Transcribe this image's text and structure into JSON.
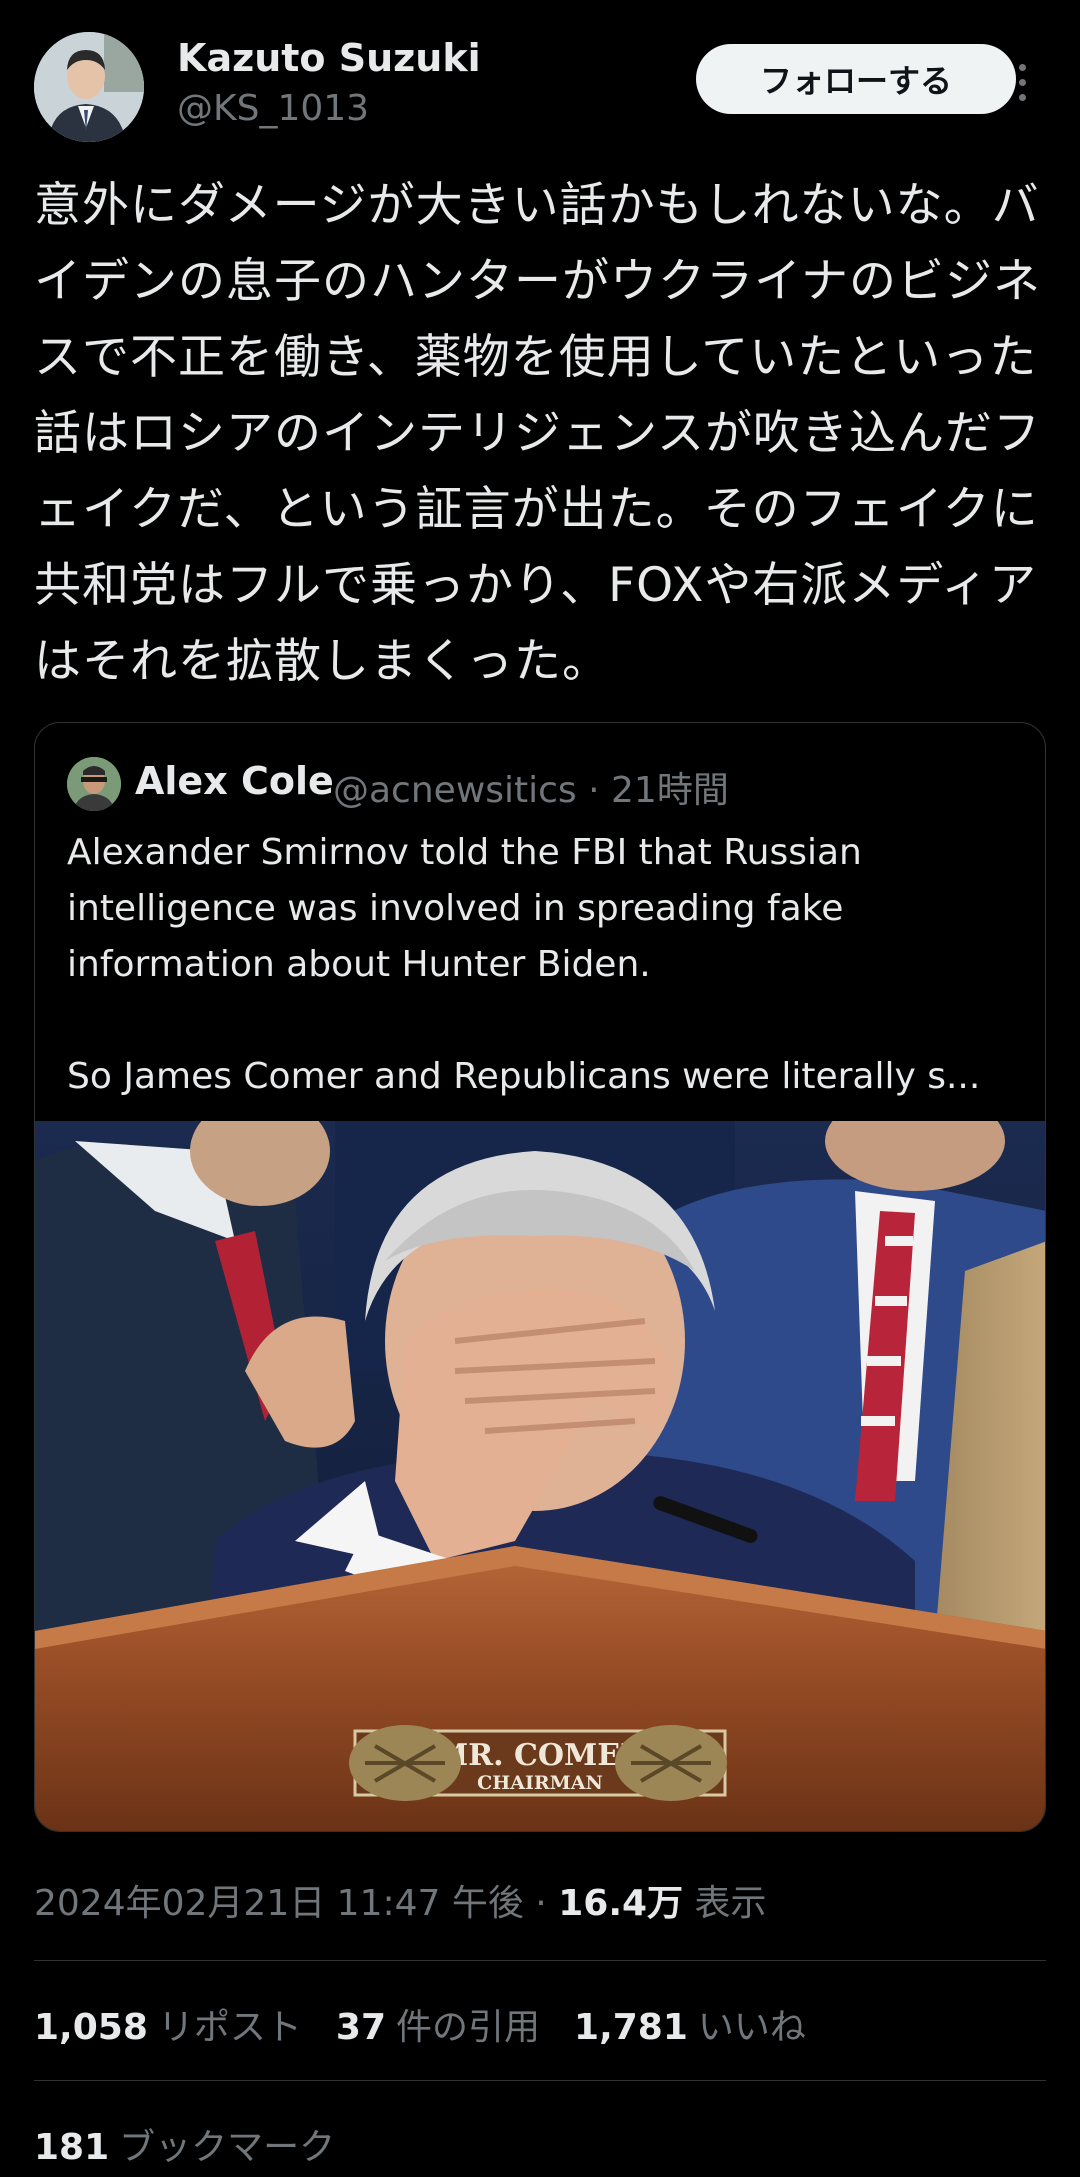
{
  "author": {
    "name": "Kazuto Suzuki",
    "handle": "@KS_1013",
    "follow_label": "フォローする"
  },
  "tweet": {
    "text": "意外にダメージが大きい話かもしれないな。バイデンの息子のハンターがウクライナのビジネスで不正を働き、薬物を使用していたといった話はロシアのインテリジェンスが吹き込んだフェイクだ、という証言が出た。そのフェイクに共和党はフルで乗っかり、FOXや右派メディアはそれを拡散しまくった。"
  },
  "quote": {
    "name": "Alex Cole",
    "handle": "@acnewsitics",
    "time": "· 21時間",
    "text": "Alexander Smirnov told the FBI that Russian intelligence was involved in spreading fake information about Hunter Biden.\n\nSo James Comer and Republicans were literally s...",
    "image": {
      "nameplate_line1": "MR. COMER",
      "nameplate_line2": "CHAIRMAN"
    }
  },
  "meta": {
    "datetime": "2024年02月21日 11:47 午後 ·",
    "views_count": "16.4万",
    "views_label": "表示"
  },
  "stats": {
    "reposts_count": "1,058",
    "reposts_label": "リポスト",
    "quotes_count": "37",
    "quotes_label": "件の引用",
    "likes_count": "1,781",
    "likes_label": "いいね",
    "bookmarks_count": "181",
    "bookmarks_label": "ブックマーク"
  },
  "icons": [
    "more-icon"
  ],
  "colors": {
    "background": "#000000",
    "text": "#e7e9ea",
    "secondary": "#71767b",
    "border": "#2f3336",
    "follow_bg": "#eff3f4"
  }
}
